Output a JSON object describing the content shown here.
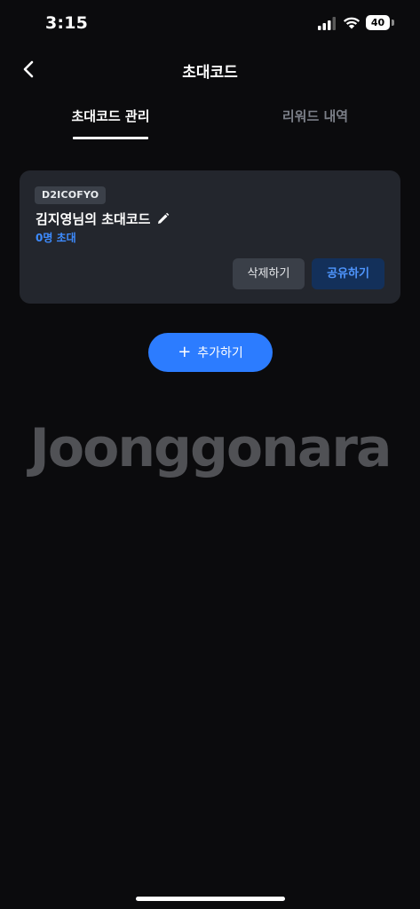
{
  "status_bar": {
    "time": "3:15",
    "battery_level": "40",
    "signal_icon": "cellular-signal-icon",
    "wifi_icon": "wifi-icon"
  },
  "header": {
    "title": "초대코드",
    "back_icon": "chevron-left-icon"
  },
  "tabs": [
    {
      "label": "초대코드 관리",
      "active": true
    },
    {
      "label": "리워드 내역",
      "active": false
    }
  ],
  "code_card": {
    "code": "D2ICOFYO",
    "name": "김지영님의 초대코드",
    "edit_icon": "pencil-icon",
    "invite_count": "0명 초대",
    "delete_label": "삭제하기",
    "share_label": "공유하기"
  },
  "add_button": {
    "icon": "plus-icon",
    "label": "추가하기"
  },
  "brand": {
    "logo_text": "Joonggonara"
  },
  "colors": {
    "background": "#0b0b0d",
    "card": "#23262d",
    "accent": "#2c7cff",
    "accent_text": "#3d8bff",
    "muted_text": "#7b7f88"
  }
}
